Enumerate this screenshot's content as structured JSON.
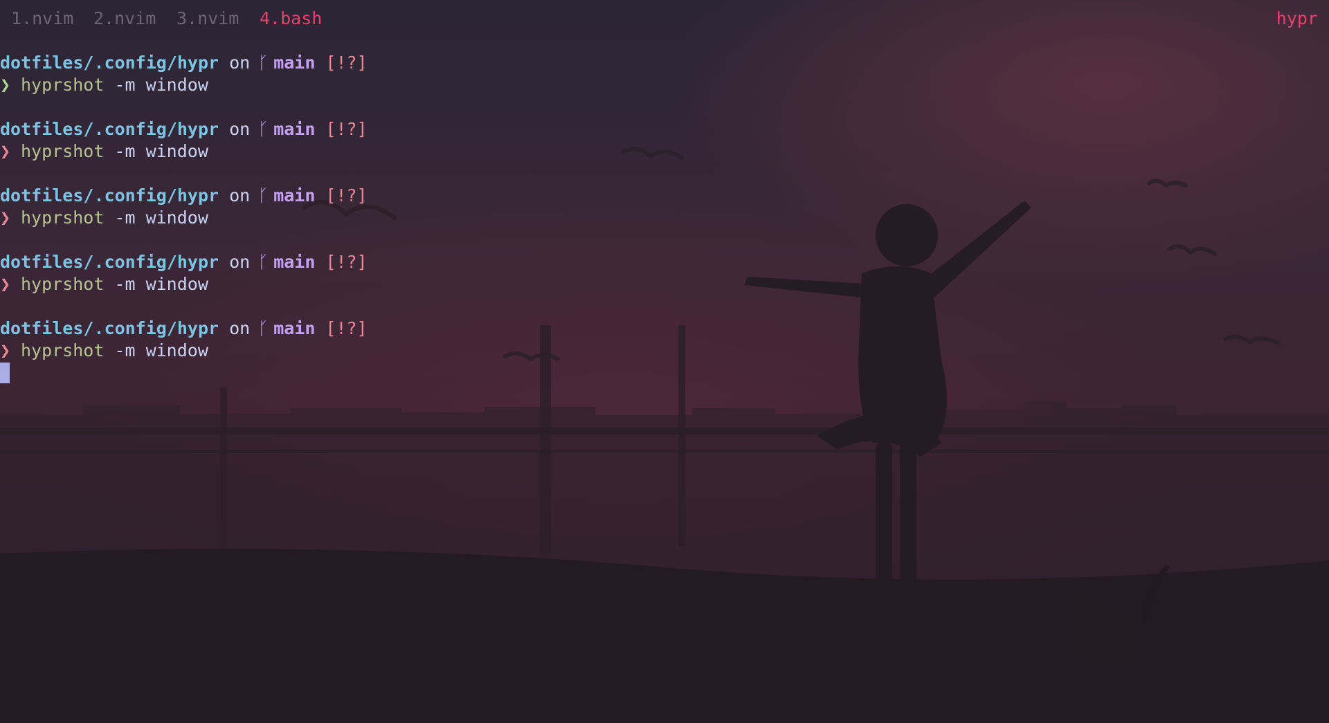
{
  "tmux": {
    "windows": [
      {
        "label": "1.nvim",
        "active": false
      },
      {
        "label": "2.nvim",
        "active": false
      },
      {
        "label": "3.nvim",
        "active": false
      },
      {
        "label": "4.bash",
        "active": true
      }
    ],
    "session": "hypr"
  },
  "terminal": {
    "prompts": [
      {
        "path": "dotfiles/.config/hypr",
        "on": "on",
        "branch_icon": "git-branch-icon",
        "branch": "main",
        "status": "[!?]",
        "symbol": "❯",
        "command": "hyprshot",
        "args": "-m window",
        "error": false
      },
      {
        "path": "dotfiles/.config/hypr",
        "on": "on",
        "branch_icon": "git-branch-icon",
        "branch": "main",
        "status": "[!?]",
        "symbol": "❯",
        "command": "hyprshot",
        "args": "-m window",
        "error": true
      },
      {
        "path": "dotfiles/.config/hypr",
        "on": "on",
        "branch_icon": "git-branch-icon",
        "branch": "main",
        "status": "[!?]",
        "symbol": "❯",
        "command": "hyprshot",
        "args": "-m window",
        "error": true
      },
      {
        "path": "dotfiles/.config/hypr",
        "on": "on",
        "branch_icon": "git-branch-icon",
        "branch": "main",
        "status": "[!?]",
        "symbol": "❯",
        "command": "hyprshot",
        "args": "-m window",
        "error": true
      },
      {
        "path": "dotfiles/.config/hypr",
        "on": "on",
        "branch_icon": "git-branch-icon",
        "branch": "main",
        "status": "[!?]",
        "symbol": "❯",
        "command": "hyprshot",
        "args": "-m window",
        "error": true
      }
    ]
  },
  "colors": {
    "accent": "#e5436a",
    "path": "#7dc4e4",
    "branch": "#c6a0f6",
    "status": "#ed8796",
    "prompt_ok": "#a6da95",
    "prompt_err": "#ed8796",
    "command": "#b5c48f",
    "cursor": "#b7bdf8"
  }
}
